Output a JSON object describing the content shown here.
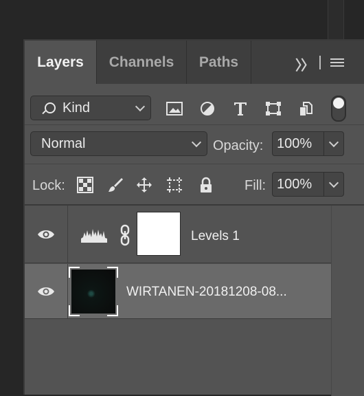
{
  "tabs": [
    {
      "label": "Layers",
      "active": true
    },
    {
      "label": "Channels",
      "active": false
    },
    {
      "label": "Paths",
      "active": false
    }
  ],
  "tab_more": "〉〉",
  "filter": {
    "kind_label": "Kind",
    "icons": [
      "pixel-filter-icon",
      "adjustment-filter-icon",
      "type-filter-icon",
      "shape-filter-icon",
      "smart-object-filter-icon"
    ]
  },
  "blend": {
    "mode": "Normal",
    "opacity_label": "Opacity:",
    "opacity_value": "100%"
  },
  "lock": {
    "label": "Lock:",
    "icons": [
      "lock-transparent-pixels-icon",
      "lock-image-pixels-icon",
      "lock-position-icon",
      "lock-artboard-icon",
      "lock-all-icon"
    ],
    "fill_label": "Fill:",
    "fill_value": "100%"
  },
  "layers": [
    {
      "name": "Levels 1",
      "type": "adjustment",
      "visible": true,
      "selected": false
    },
    {
      "name": "WIRTANEN-20181208-08...",
      "type": "image",
      "visible": true,
      "selected": true
    }
  ],
  "colors": {
    "panel": "#535353",
    "tabbar": "#3e3e3e",
    "selected_layer": "#6a6a6a",
    "text": "#f0f0f0"
  }
}
